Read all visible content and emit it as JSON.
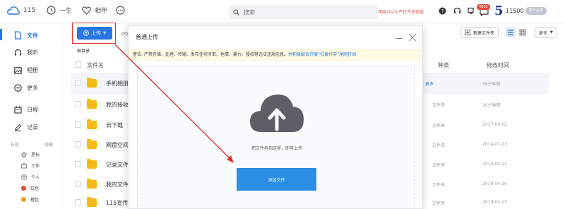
{
  "topbar": {
    "logo_label": "115",
    "life_label": "一生",
    "album_label": "相伴",
    "search_placeholder": "搜索",
    "notice": "净网2020 严打不良信息",
    "badge": "4802",
    "brand_digit": "5",
    "user_number": "11500",
    "vip_label": "原汁会员"
  },
  "sidebar": {
    "items": [
      {
        "label": "文件",
        "icon": "file-icon"
      },
      {
        "label": "我听",
        "icon": "headphone-icon"
      },
      {
        "label": "相册",
        "icon": "photo-icon"
      },
      {
        "label": "更多",
        "icon": "more-circle-icon"
      },
      {
        "label": "日程",
        "icon": "calendar-icon"
      },
      {
        "label": "记录",
        "icon": "edit-icon"
      }
    ],
    "tags_header": "标签",
    "tags_manage": "隐藏",
    "tags": [
      {
        "label": "星标",
        "color": "#999999"
      },
      {
        "label": "工作",
        "color": "#999999"
      },
      {
        "label": "个人",
        "color": "#999999"
      },
      {
        "label": "红色",
        "color": "#e5483c"
      },
      {
        "label": "橙色",
        "color": "#f39c1f"
      }
    ]
  },
  "main": {
    "upload_label": "上传",
    "breadcrumb": "根目录",
    "col_name": "文件名",
    "col_type": "种类",
    "col_time": "修改时间",
    "new_folder_label": "新建文件夹",
    "more_label": "更多",
    "more_link": "更多",
    "rows": [
      {
        "name": "手机相册",
        "type": "",
        "time": "58分钟前"
      },
      {
        "name": "我的接收",
        "type": "文件夹",
        "time": "26分钟前"
      },
      {
        "name": "云下载",
        "type": "文件夹",
        "time": "2017-09-02"
      },
      {
        "name": "网盘空间",
        "type": "文件夹",
        "time": "2014-07-23"
      },
      {
        "name": "记录文件",
        "type": "文件夹",
        "time": "2019-05-24"
      },
      {
        "name": "我的文件",
        "type": "文件夹",
        "time": "2019-04-30"
      },
      {
        "name": "115宣传",
        "type": "文件夹",
        "time": "2019-05-23"
      }
    ]
  },
  "modal": {
    "title": "普通上传",
    "warning": "警告: 严禁存储、处理、传输、发布任何涉密、色情、暴力、侵权等违法违规信息。",
    "warning_link": "并积极配合开展“扫黄打非”净网行动",
    "drop_hint": "把文件拖到这里，即可上传",
    "add_file_label": "添加文件",
    "accent": "#2b8ee5"
  }
}
